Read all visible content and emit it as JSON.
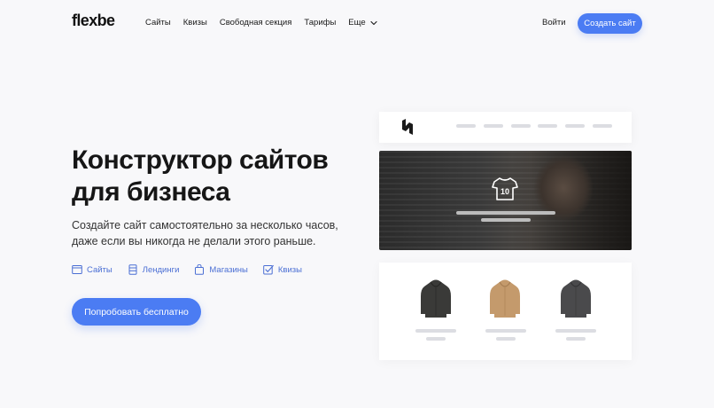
{
  "header": {
    "logo": "flexbe",
    "nav": [
      "Сайты",
      "Квизы",
      "Свободная секция",
      "Тарифы"
    ],
    "more_label": "Еще",
    "login_label": "Войти",
    "create_label": "Создать сайт"
  },
  "hero": {
    "title_line1": "Конструктор сайтов",
    "title_line2": "для бизнеса",
    "subtitle": "Создайте сайт самостоятельно за несколько часов, даже если вы никогда не делали этого раньше.",
    "features": [
      {
        "label": "Сайты",
        "icon": "browser-window-icon"
      },
      {
        "label": "Лендинги",
        "icon": "landing-page-icon"
      },
      {
        "label": "Магазины",
        "icon": "shopping-bag-icon"
      },
      {
        "label": "Квизы",
        "icon": "checkbox-icon"
      }
    ],
    "cta_label": "Попробовать бесплатно"
  },
  "preview": {
    "banner_badge": "10",
    "products": [
      {
        "name": "black-hoodie",
        "color": "#3a3a38"
      },
      {
        "name": "tan-hoodie",
        "color": "#c49a6c"
      },
      {
        "name": "dark-gray-hoodie",
        "color": "#4a4a4c"
      }
    ]
  },
  "colors": {
    "accent": "#4b7cf3",
    "feature_text": "#4b6fd4",
    "background": "#f8f8fa"
  }
}
